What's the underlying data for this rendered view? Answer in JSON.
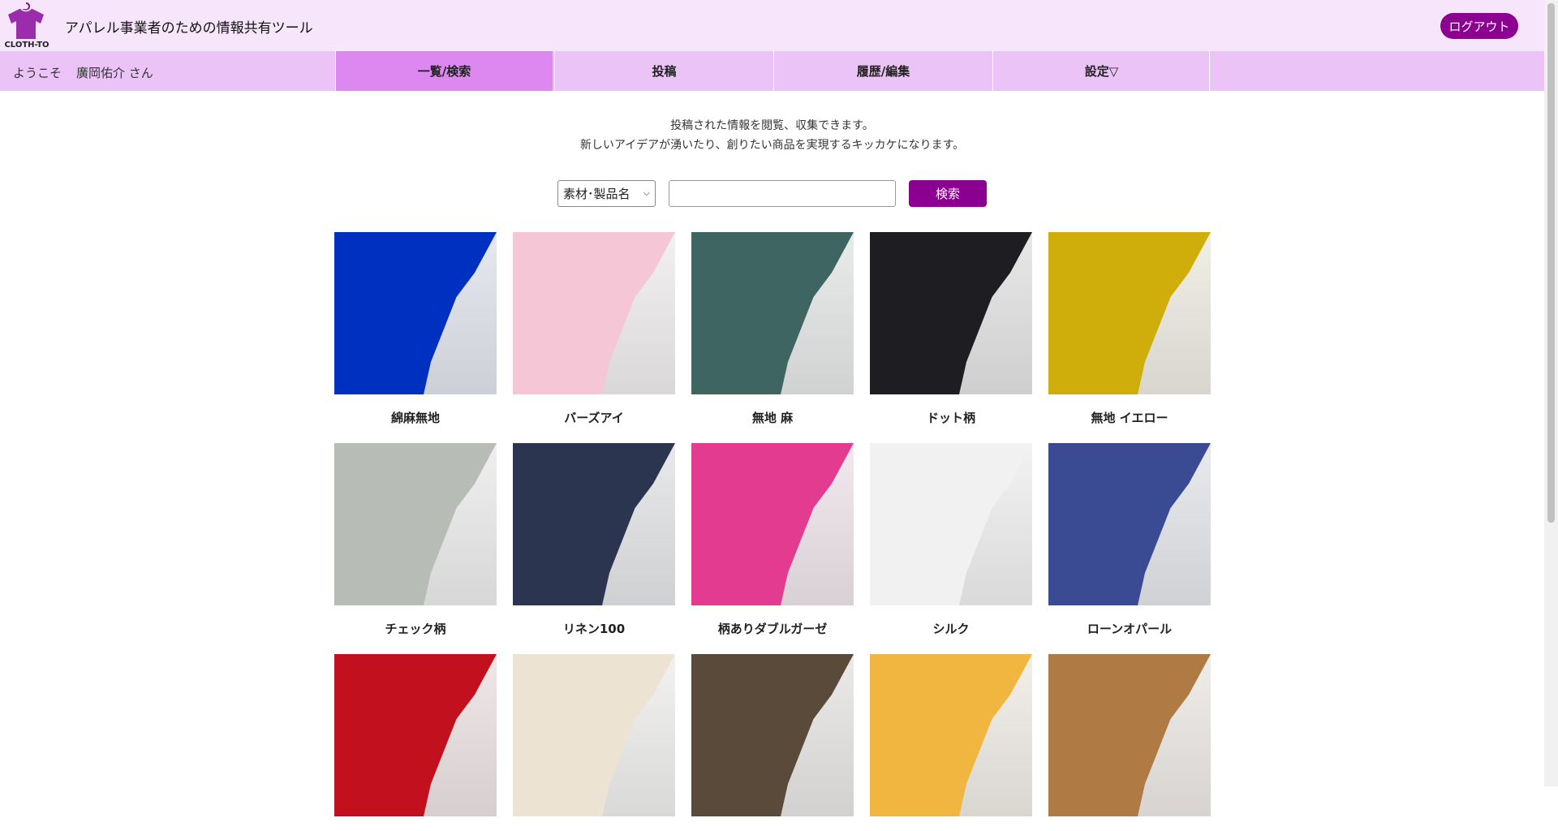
{
  "header": {
    "logo_text": "CLOTH-TO",
    "title": "アパレル事業者のための情報共有ツール",
    "logout_label": "ログアウト"
  },
  "nav": {
    "welcome": "ようこそ",
    "user_name": "廣岡佑介 さん",
    "items": [
      {
        "label": "一覧/検索",
        "active": true
      },
      {
        "label": "投稿",
        "active": false
      },
      {
        "label": "履歴/編集",
        "active": false
      },
      {
        "label": "設定▽",
        "active": false
      }
    ]
  },
  "intro": {
    "line1": "投稿された情報を閲覧、収集できます。",
    "line2": "新しいアイデアが湧いたり、創りたい商品を実現するキッカケになります。"
  },
  "search": {
    "category_selected": "素材･製品名",
    "query_value": "",
    "button_label": "検索"
  },
  "items": [
    {
      "label": "綿麻無地",
      "color": "#0030c0"
    },
    {
      "label": "バーズアイ",
      "color": "#f4c6d6"
    },
    {
      "label": "無地 麻",
      "color": "#3f6563"
    },
    {
      "label": "ドット柄",
      "color": "#1e1d22"
    },
    {
      "label": "無地 イエロー",
      "color": "#cfae0c"
    },
    {
      "label": "チェック柄",
      "color": "#b8bcb6"
    },
    {
      "label": "リネン100",
      "color": "#2c3550"
    },
    {
      "label": "柄ありダブルガーゼ",
      "color": "#e33b8f"
    },
    {
      "label": "シルク",
      "color": "#f1f1f1"
    },
    {
      "label": "ローンオパール",
      "color": "#3a4a93"
    },
    {
      "label": "",
      "color": "#c2101f"
    },
    {
      "label": "",
      "color": "#ede3d2"
    },
    {
      "label": "",
      "color": "#5a4a3a"
    },
    {
      "label": "",
      "color": "#f0b640"
    },
    {
      "label": "",
      "color": "#b07a45"
    }
  ]
}
